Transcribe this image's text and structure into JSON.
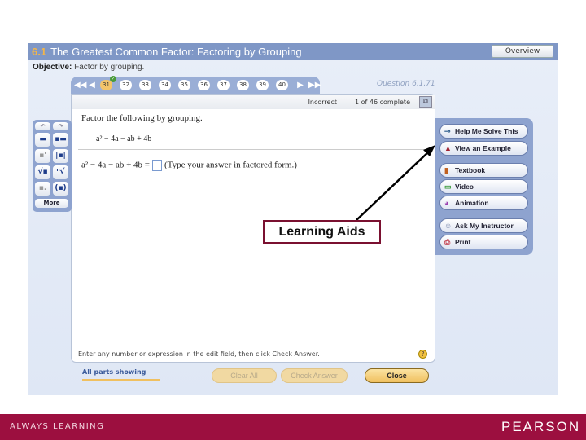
{
  "title": {
    "section": "6.1",
    "text": "The Greatest Common Factor: Factoring by Grouping",
    "overview_label": "Overview"
  },
  "objective": {
    "label": "Objective:",
    "text": "Factor by grouping."
  },
  "nav": {
    "first": "◀◀",
    "prev": "◀",
    "next": "▶",
    "last": "▶▶",
    "questions": [
      "31",
      "32",
      "33",
      "34",
      "35",
      "36",
      "37",
      "38",
      "39",
      "40"
    ],
    "current": "31"
  },
  "question": {
    "label": "Question 6.1.71",
    "status": "Incorrect",
    "progress": "1 of 46 complete",
    "prompt": "Factor the following by grouping.",
    "expression": "a² − 4a − ab + 4b",
    "answer_prefix": "a² − 4a − ab + 4b =",
    "answer_hint": "(Type your answer in factored form.)",
    "instructions": "Enter any number or expression in the edit field, then click Check Answer."
  },
  "learning_aids": [
    {
      "label": "Help Me Solve This",
      "icon": "key-icon"
    },
    {
      "label": "View an Example",
      "icon": "example-icon"
    },
    {
      "label": "Textbook",
      "icon": "book-icon"
    },
    {
      "label": "Video",
      "icon": "video-icon"
    },
    {
      "label": "Animation",
      "icon": "animation-icon"
    },
    {
      "label": "Ask My Instructor",
      "icon": "instructor-icon"
    },
    {
      "label": "Print",
      "icon": "printer-icon"
    }
  ],
  "palette": {
    "undo": "↶",
    "redo": "↷",
    "more": "More"
  },
  "bottom": {
    "all_parts": "All parts showing",
    "clear_all": "Clear All",
    "check_answer": "Check Answer",
    "close": "Close"
  },
  "callout": "Learning Aids",
  "footer": {
    "tagline": "ALWAYS LEARNING",
    "brand": "PEARSON"
  },
  "colors": {
    "title_bar": "#7f97c6",
    "footer": "#9c0f3f",
    "accent": "#f0c060"
  }
}
